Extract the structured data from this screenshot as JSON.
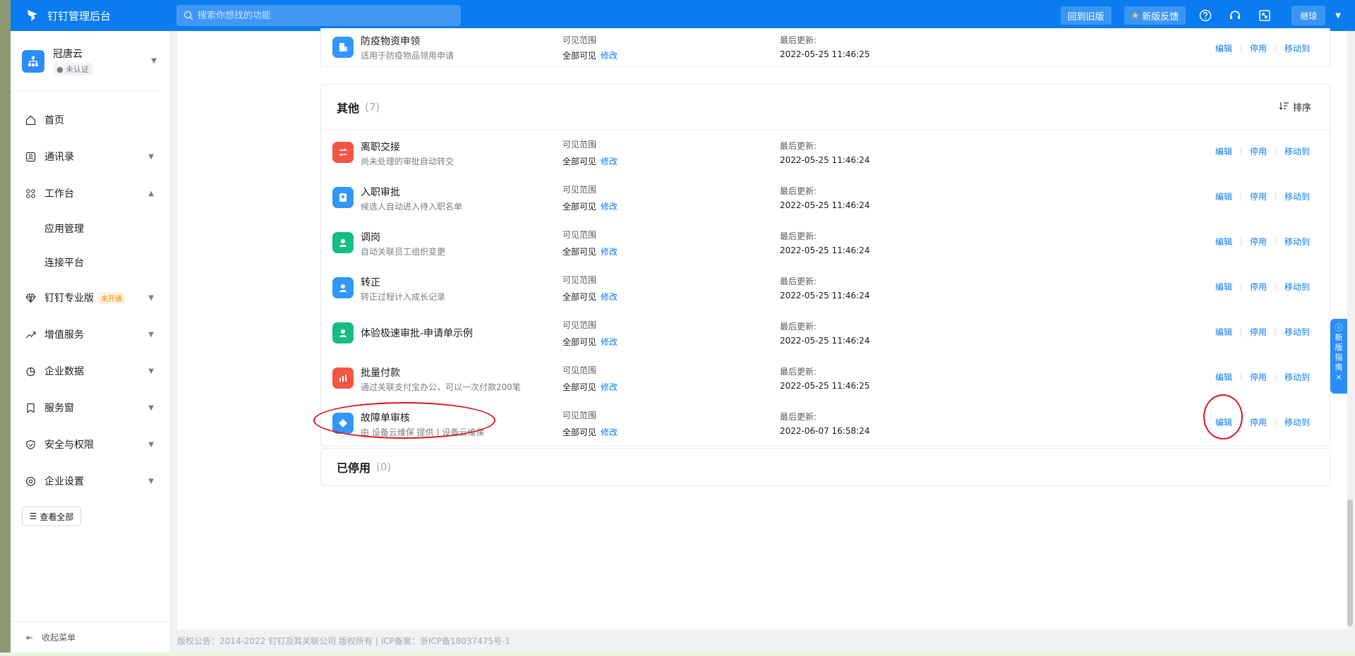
{
  "topbar": {
    "brand": "钉钉管理后台",
    "search_placeholder": "搜索你想找的功能",
    "back_old": "回到旧版",
    "feedback": "新版反馈",
    "user": "继琼"
  },
  "sidebar": {
    "org_name": "冠唐云",
    "org_badge": "未认证",
    "items": [
      {
        "label": "首页"
      },
      {
        "label": "通讯录"
      },
      {
        "label": "工作台"
      },
      {
        "label": "应用管理"
      },
      {
        "label": "连接平台"
      },
      {
        "label": "钉钉专业版",
        "tag": "未开通"
      },
      {
        "label": "增值服务"
      },
      {
        "label": "企业数据"
      },
      {
        "label": "服务窗"
      },
      {
        "label": "安全与权限"
      },
      {
        "label": "企业设置"
      }
    ],
    "view_all": "查看全部",
    "collapse": "收起菜单"
  },
  "top_row": {
    "name": "防疫物资申领",
    "desc": "适用于防疫物品领用申请",
    "vis_label": "可见范围",
    "vis_value": "全部可见",
    "vis_edit": "修改",
    "upd_label": "最后更新:",
    "upd_value": "2022-05-25 11:46:25",
    "ops": [
      "编辑",
      "停用",
      "移动到"
    ]
  },
  "group_other": {
    "title": "其他",
    "count": "(7)",
    "sort": "排序",
    "rows": [
      {
        "name": "离职交接",
        "desc": "尚未处理的审批自动转交",
        "upd": "2022-05-25 11:46:24",
        "color": "#f25643"
      },
      {
        "name": "入职审批",
        "desc": "候选人自动进入待入职名单",
        "upd": "2022-05-25 11:46:24",
        "color": "#3296fa"
      },
      {
        "name": "调岗",
        "desc": "自动关联员工组织变更",
        "upd": "2022-05-25 11:46:24",
        "color": "#15bc83"
      },
      {
        "name": "转正",
        "desc": "转正过程计入成长记录",
        "upd": "2022-05-25 11:46:24",
        "color": "#3296fa"
      },
      {
        "name": "体验极速审批-申请单示例",
        "desc": "",
        "upd": "2022-05-25 11:46:24",
        "color": "#15bc83"
      },
      {
        "name": "批量付款",
        "desc": "通过关联支付宝办公，可以一次付款200笔",
        "upd": "2022-05-25 11:46:25",
        "color": "#f25643"
      },
      {
        "name": "故障单审核",
        "desc": "由 设备云维保 提供 | 设备云维保",
        "upd": "2022-06-07 16:58:24",
        "color": "#3296fa"
      }
    ],
    "vis_label": "可见范围",
    "vis_value": "全部可见",
    "vis_edit": "修改",
    "upd_label": "最后更新:",
    "ops": [
      "编辑",
      "停用",
      "移动到"
    ]
  },
  "group_disabled": {
    "title": "已停用",
    "count": "(0)"
  },
  "footer": "版权公告：2014-2022 钉钉及其关联公司 版权所有 | ICP备案：浙ICP备18037475号-1",
  "guide": {
    "line1": "新",
    "line2": "版",
    "line3": "指",
    "line4": "南"
  }
}
